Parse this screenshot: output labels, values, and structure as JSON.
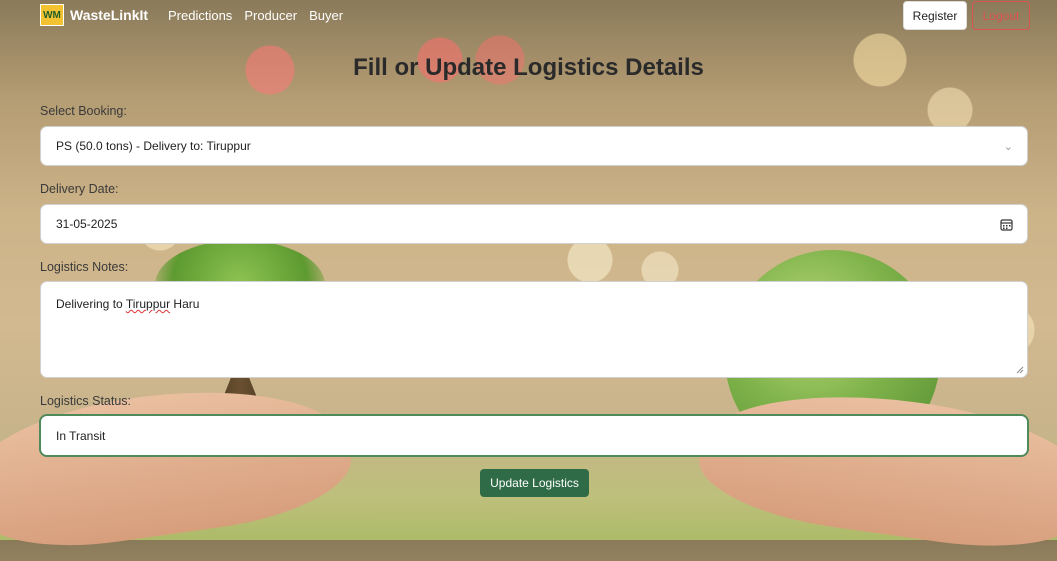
{
  "navbar": {
    "logo_text": "WM",
    "brand": "WasteLinkIt",
    "links": [
      "Predictions",
      "Producer",
      "Buyer"
    ],
    "register_label": "Register",
    "logout_label": "Logout"
  },
  "page_title": "Fill or Update Logistics Details",
  "form": {
    "booking_label": "Select Booking:",
    "booking_value": "PS (50.0 tons) - Delivery to: Tiruppur",
    "delivery_date_label": "Delivery Date:",
    "delivery_date_value": "31-05-2025",
    "notes_label": "Logistics Notes:",
    "notes_prefix": "Delivering to ",
    "notes_highlight": "Tiruppur",
    "notes_suffix": " Haru",
    "status_label": "Logistics Status:",
    "status_value": "In Transit",
    "submit_label": "Update Logistics"
  },
  "colors": {
    "primary_green": "#2f6b47",
    "logout_red": "#d9534f",
    "focus_border": "#4f8a5b"
  },
  "icons": [
    "chevron-down-icon",
    "calendar-icon",
    "resize-handle-icon"
  ]
}
